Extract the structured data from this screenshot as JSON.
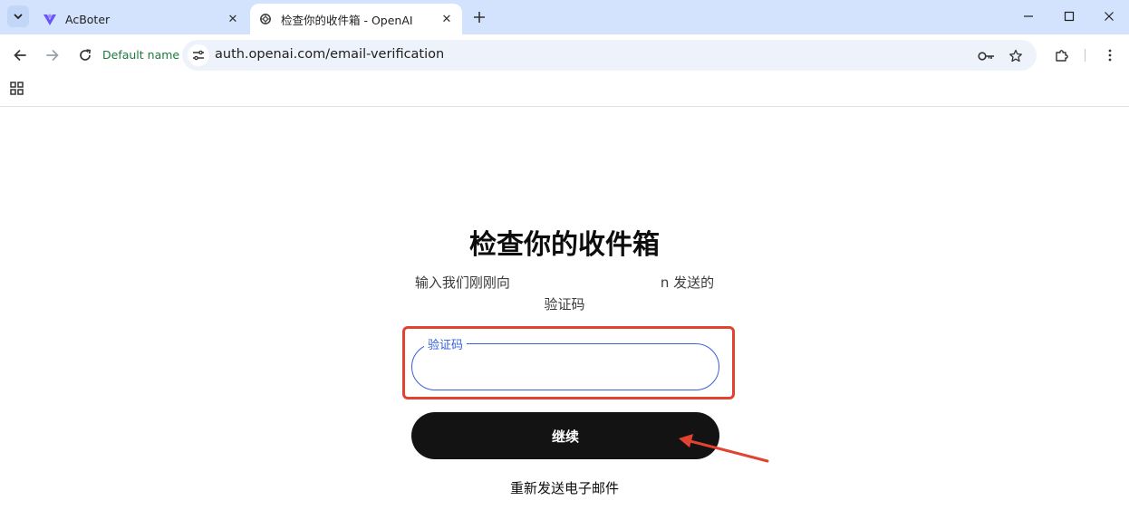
{
  "tabs": [
    {
      "title": "AcBoter",
      "active": false,
      "icon": "acboter-logo-icon"
    },
    {
      "title": "检查你的收件箱 - OpenAI",
      "active": true,
      "icon": "openai-logo-icon"
    }
  ],
  "toolbar": {
    "profile_name": "Default name",
    "url": "auth.openai.com/email-verification"
  },
  "page": {
    "heading": "检查你的收件箱",
    "subtitle_before": "输入我们刚刚向",
    "subtitle_after": "n 发送的验证码",
    "code_field_label": "验证码",
    "code_field_value": "",
    "continue_label": "继续",
    "resend_label": "重新发送电子邮件"
  },
  "colors": {
    "tabstrip": "#d3e3fd",
    "accent_blue": "#3560d9",
    "button_dark": "#131313",
    "annotation_red": "#e0432f",
    "profile_green": "#1a7a3d"
  }
}
